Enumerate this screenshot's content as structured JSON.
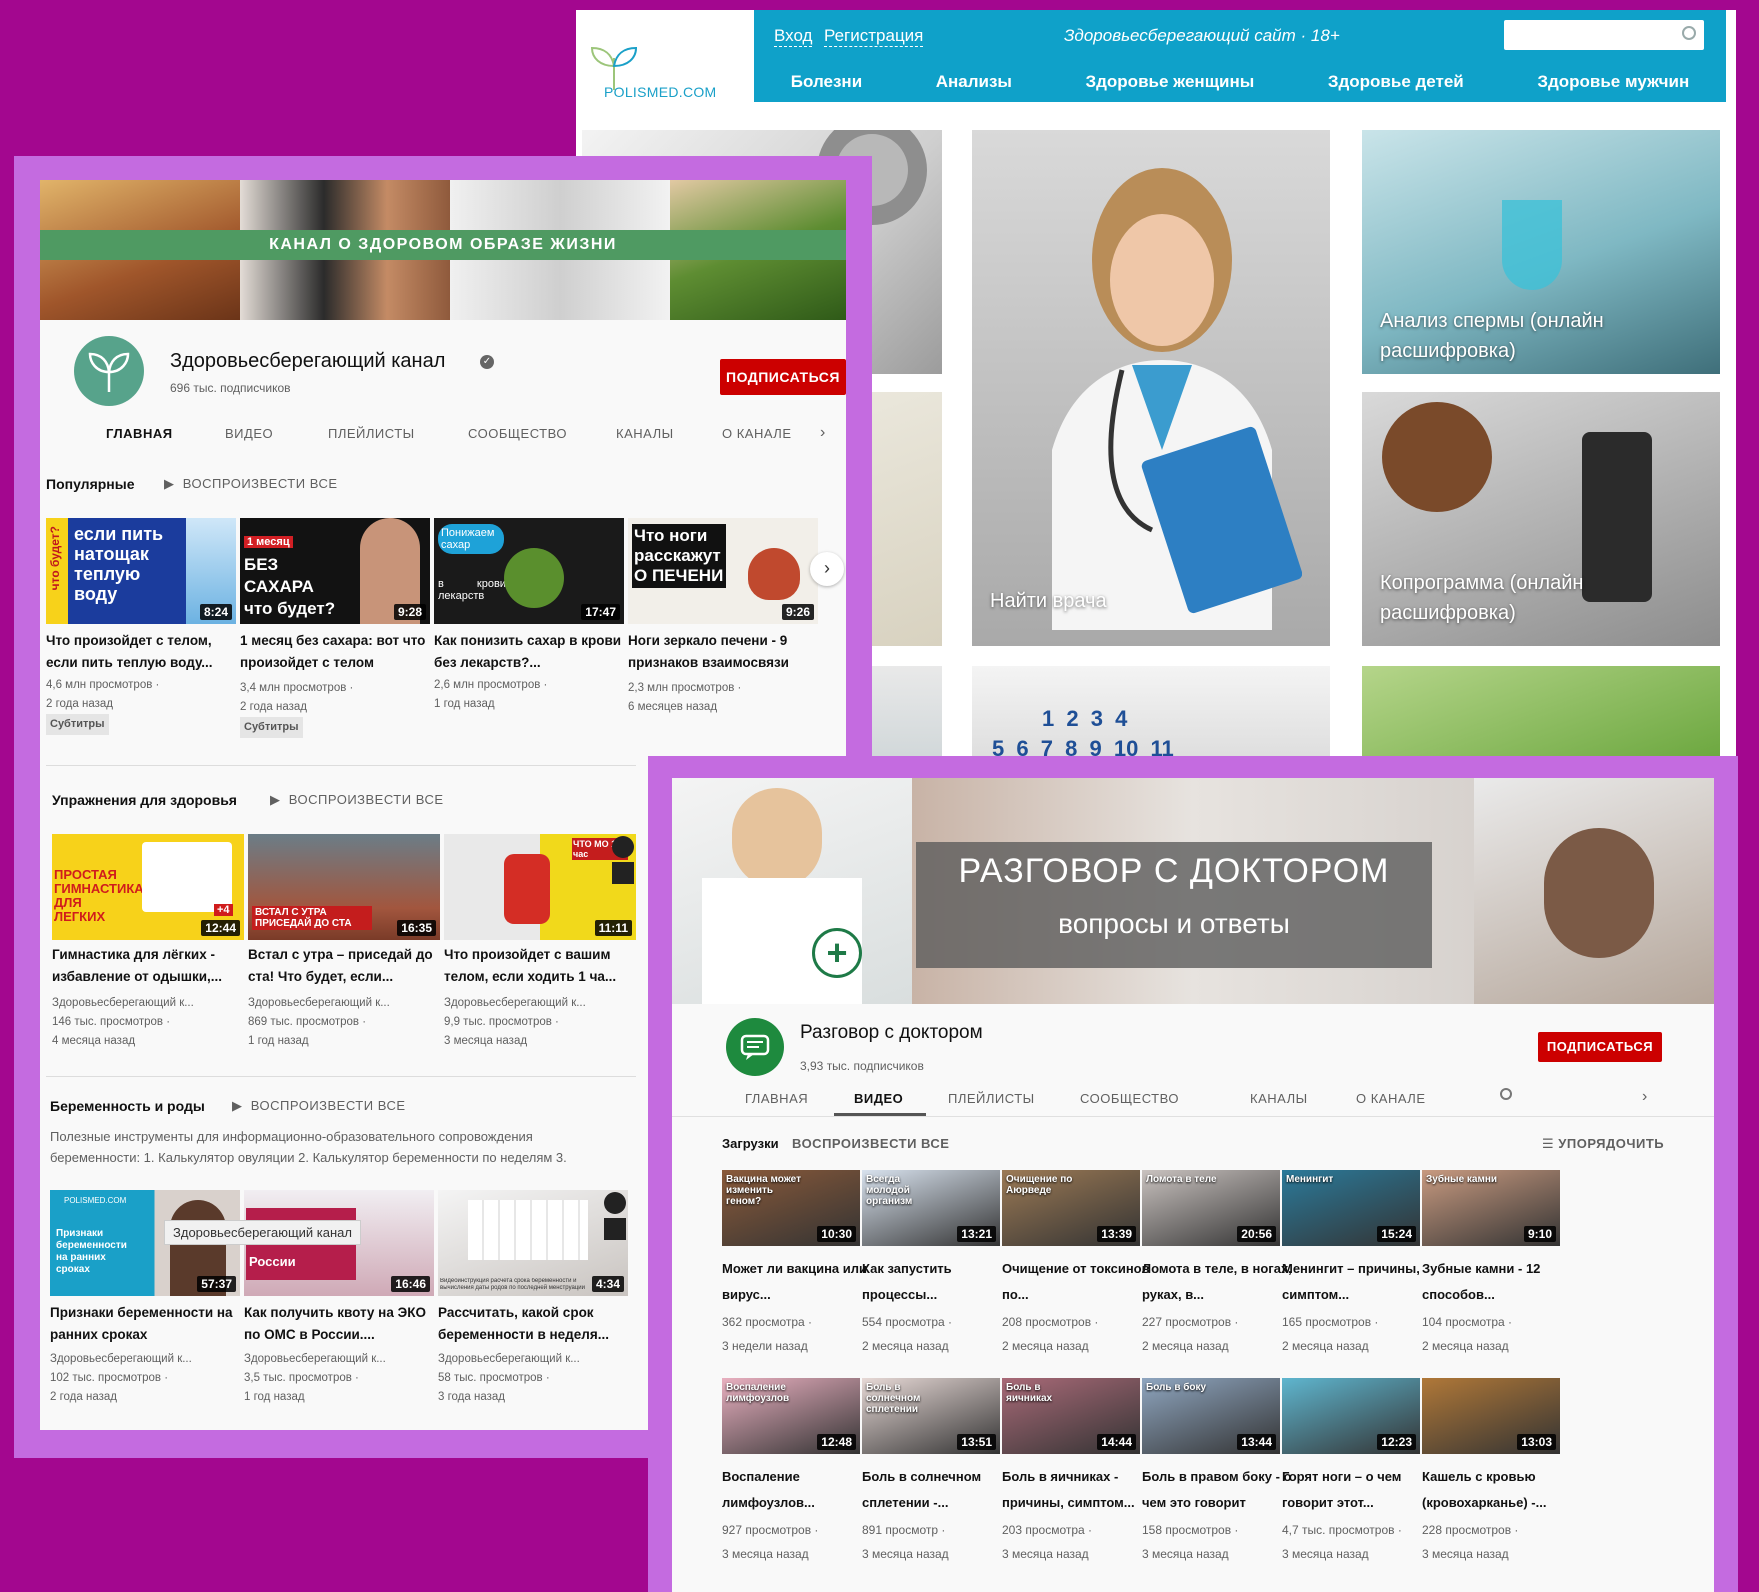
{
  "site": {
    "logo_text": "POLISMED.COM",
    "login": "Вход",
    "register": "Регистрация",
    "slogan": "Здоровьесберегающий сайт  ·  18+",
    "menu": [
      "Болезни",
      "Анализы",
      "Здоровье женщины",
      "Здоровье детей",
      "Здоровье мужчин"
    ],
    "tiles": {
      "find_doctor": "Найти врача",
      "sperm": "Анализ спермы (онлайн расшифровка)",
      "copro": "Копрограмма (онлайн расшифровка)"
    },
    "calendar_digits": [
      "1",
      "2",
      "3",
      "4",
      "5",
      "6",
      "7",
      "8",
      "9",
      "10",
      "11"
    ],
    "colors": {
      "nav": "#0fa1c9"
    }
  },
  "channel1": {
    "banner_text": "КАНАЛ О ЗДОРОВОМ ОБРАЗЕ ЖИЗНИ",
    "name": "Здоровьесберегающий канал",
    "subscribers": "696 тыс. подписчиков",
    "subscribe": "ПОДПИСАТЬСЯ",
    "tabs": [
      "ГЛАВНАЯ",
      "ВИДЕО",
      "ПЛЕЙЛИСТЫ",
      "СООБЩЕСТВО",
      "КАНАЛЫ",
      "О КАНАЛЕ"
    ],
    "play_all": "ВОСПРОИЗВЕСТИ ВСЕ",
    "tooltip": "Здоровьесберегающий канал",
    "shelves": [
      {
        "title": "Популярные",
        "videos": [
          {
            "thumb": "если пить натощак теплую воду",
            "side": "что будет?",
            "duration": "8:24",
            "title": "Что произойдет с телом, если пить теплую воду...",
            "views": "4,6 млн просмотров ·",
            "age": "2 года назад",
            "badge": "Субтитры"
          },
          {
            "thumb": "БЕЗ САХАРА что будет?",
            "side": "1 месяц",
            "duration": "9:28",
            "title": "1 месяц без сахара: вот что произойдет с телом",
            "views": "3,4 млн просмотров ·",
            "age": "2 года назад",
            "badge": "Субтитры"
          },
          {
            "thumb": "Понижаем сахар",
            "side": "в крови   без лекарств",
            "duration": "17:47",
            "title": "Как понизить сахар в крови без лекарств?...",
            "views": "2,6 млн просмотров ·",
            "age": "1 год назад",
            "badge": ""
          },
          {
            "thumb": "Что ноги расскажут О ПЕЧЕНИ",
            "side": "",
            "duration": "9:26",
            "title": "Ноги зеркало печени - 9 признаков взаимосвязи",
            "views": "2,3 млн просмотров ·",
            "age": "6 месяцев назад",
            "badge": ""
          }
        ]
      },
      {
        "title": "Упражнения для здоровья",
        "videos": [
          {
            "thumb": "ПРОСТАЯ ГИМНАСТИКА ДЛЯ ЛЕГКИХ",
            "side": "+4",
            "duration": "12:44",
            "title": "Гимнастика для лёгких - избавление от одышки,...",
            "channel": "Здоровьесберегающий к...",
            "views": "146 тыс. просмотров ·",
            "age": "4 месяца назад"
          },
          {
            "thumb": "ВСТАЛ С УТРА ПРИСЕДАЙ ДО СТА",
            "side": "",
            "duration": "16:35",
            "title": "Встал с утра – приседай до ста! Что будет, если...",
            "channel": "Здоровьесберегающий к...",
            "views": "869 тыс. просмотров ·",
            "age": "1 год назад"
          },
          {
            "thumb": "ЧТО МО 1 час",
            "side": "",
            "duration": "11:11",
            "title": "Что произойдет с вашим телом, если ходить 1 ча...",
            "channel": "Здоровьесберегающий к...",
            "views": "9,9 тыс. просмотров ·",
            "age": "3 месяца назад"
          }
        ]
      },
      {
        "title": "Беременность и роды",
        "description": "Полезные инструменты для информационно-образовательного сопровождения беременности: 1. Калькулятор овуляции 2. Калькулятор беременности по неделям 3.",
        "videos": [
          {
            "thumb": "Признаки беременности на ранних сроках",
            "side": "POLISMED.COM",
            "duration": "57:37",
            "title": "Признаки беременности на ранних сроках",
            "channel": "Здоровьесберегающий к...",
            "views": "102 тыс. просмотров ·",
            "age": "2 года назад"
          },
          {
            "thumb": "Как получить   в России",
            "side": "",
            "duration": "16:46",
            "title": "Как получить квоту на ЭКО по ОМС в России....",
            "channel": "Здоровьесберегающий к...",
            "views": "3,5 тыс. просмотров ·",
            "age": "1 год назад"
          },
          {
            "thumb": "Видеоинструкция расчета срока беременности и вычисления даты родов по последней менструации",
            "side": "",
            "duration": "4:34",
            "title": "Рассчитать, какой срок беременности в неделя...",
            "channel": "Здоровьесберегающий к...",
            "views": "58 тыс. просмотров ·",
            "age": "3 года назад"
          }
        ]
      }
    ]
  },
  "channel2": {
    "banner_title": "РАЗГОВОР С ДОКТОРОМ",
    "banner_sub": "вопросы и ответы",
    "name": "Разговор с доктором",
    "subscribers": "3,93 тыс. подписчиков",
    "subscribe": "ПОДПИСАТЬСЯ",
    "tabs": [
      "ГЛАВНАЯ",
      "ВИДЕО",
      "ПЛЕЙЛИСТЫ",
      "СООБЩЕСТВО",
      "КАНАЛЫ",
      "О КАНАЛЕ"
    ],
    "uploads": "Загрузки",
    "play_all": "ВОСПРОИЗВЕСТИ ВСЕ",
    "sort": "УПОРЯДОЧИТЬ",
    "videos": [
      {
        "thumb": "Вакцина может изменить геном?",
        "duration": "10:30",
        "title": "Может ли вакцина или вирус...",
        "views": "362 просмотра ·",
        "age": "3 недели назад",
        "bg": "#8a5a3a"
      },
      {
        "thumb": "Всегда молодой организм",
        "duration": "13:21",
        "title": "Как запустить процессы...",
        "views": "554 просмотра ·",
        "age": "2 месяца назад",
        "bg": "#d8e2ee"
      },
      {
        "thumb": "Очищение по Аюрведе",
        "duration": "13:39",
        "title": "Очищение от токсинов по...",
        "views": "208 просмотров ·",
        "age": "2 месяца назад",
        "bg": "#9c7a55"
      },
      {
        "thumb": "Ломота в теле",
        "duration": "20:56",
        "title": "Ломота в теле, в ногах, руках, в...",
        "views": "227 просмотров ·",
        "age": "2 месяца назад",
        "bg": "#c9c2bf"
      },
      {
        "thumb": "Менингит",
        "duration": "15:24",
        "title": "Менингит – причины, симптом...",
        "views": "165 просмотров ·",
        "age": "2 месяца назад",
        "bg": "#2b7a9a"
      },
      {
        "thumb": "Зубные камни",
        "duration": "9:10",
        "title": "Зубные камни - 12 способов...",
        "views": "104 просмотра ·",
        "age": "2 месяца назад",
        "bg": "#c89a80"
      },
      {
        "thumb": "Воспаление лимфоузлов",
        "duration": "12:48",
        "title": "Воспаление лимфоузлов...",
        "views": "927 просмотров ·",
        "age": "3 месяца назад",
        "bg": "#e9b0c0"
      },
      {
        "thumb": "Боль в солнечном сплетении",
        "duration": "13:51",
        "title": "Боль в солнечном сплетении -...",
        "views": "891 просмотр ·",
        "age": "3 месяца назад",
        "bg": "#e7d9d6"
      },
      {
        "thumb": "Боль в яичниках",
        "duration": "14:44",
        "title": "Боль в яичниках - причины, симптом...",
        "views": "203 просмотра ·",
        "age": "3 месяца назад",
        "bg": "#a96a78"
      },
      {
        "thumb": "Боль в боку",
        "duration": "13:44",
        "title": "Боль в правом боку - о чем это говорит",
        "views": "158 просмотров ·",
        "age": "3 месяца назад",
        "bg": "#8fa6c0"
      },
      {
        "thumb": "",
        "duration": "12:23",
        "title": "Горят ноги – о чем говорит этот...",
        "views": "4,7 тыс. просмотров ·",
        "age": "3 месяца назад",
        "bg": "#5fb6cf"
      },
      {
        "thumb": "",
        "duration": "13:03",
        "title": "Кашель с кровью (кровохарканье) -...",
        "views": "228 просмотров ·",
        "age": "3 месяца назад",
        "bg": "#b07838"
      }
    ]
  },
  "colors": {
    "background": "#a3078f",
    "frame": "#c46be0",
    "subscribe": "#cc0000",
    "green_bar": "#4f9a62"
  }
}
